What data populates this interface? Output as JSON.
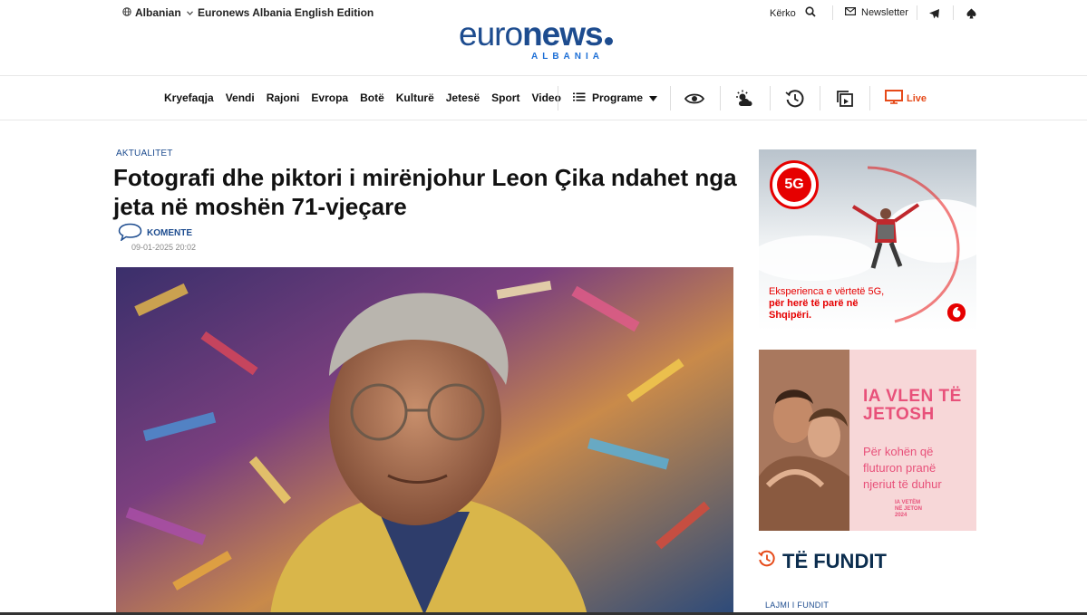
{
  "topbar": {
    "language": "Albanian",
    "edition": "Euronews Albania English Edition",
    "search_label": "Kërko",
    "newsletter_label": "Newsletter"
  },
  "logo": {
    "word_light": "euro",
    "word_bold": "news",
    "sub": "ALBANIA"
  },
  "nav": {
    "items": [
      "Kryefaqja",
      "Vendi",
      "Rajoni",
      "Evropa",
      "Botë",
      "Kulturë",
      "Jetesë",
      "Sport",
      "Video"
    ],
    "programs_label": "Programe",
    "live_label": "Live"
  },
  "article": {
    "category": "AKTUALITET",
    "title": "Fotografi dhe piktori i mirënjohur Leon Çika ndahet nga jeta në moshën 71-vjeçare",
    "comments_label": "KOMENTE",
    "date": "09-01-2025 20:02"
  },
  "sidebar": {
    "ad1": {
      "badge": "5G",
      "line1": "Eksperienca e vërtetë 5G,",
      "line2": "për herë të parë në",
      "line3": "Shqipëri."
    },
    "ad2": {
      "headline1": "IA VLEN TË",
      "headline2": "JETOSH",
      "body1": "Për kohën që",
      "body2": "fluturon pranë",
      "body3": "njeriut të duhur",
      "mini1": "IA VETËM",
      "mini2": "NË JETON",
      "mini3": "2024"
    },
    "latest_title": "TË FUNDIT",
    "latest_sub": "LAJMI I FUNDIT"
  },
  "colors": {
    "brand": "#1d4c8f",
    "live": "#e64a19",
    "vodafone": "#e60000",
    "ad_pink": "#e8517a",
    "latest": "#0b2d4e"
  }
}
